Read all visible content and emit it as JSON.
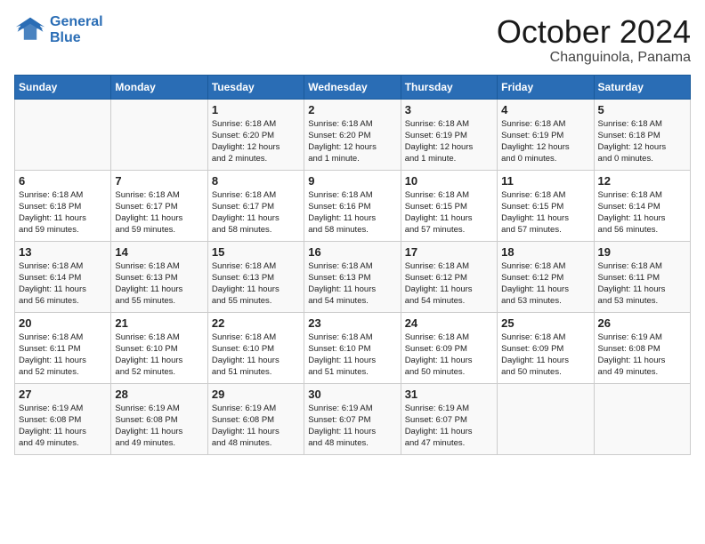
{
  "header": {
    "logo_line1": "General",
    "logo_line2": "Blue",
    "month": "October 2024",
    "location": "Changuinola, Panama"
  },
  "weekdays": [
    "Sunday",
    "Monday",
    "Tuesday",
    "Wednesday",
    "Thursday",
    "Friday",
    "Saturday"
  ],
  "weeks": [
    [
      {
        "day": "",
        "info": ""
      },
      {
        "day": "",
        "info": ""
      },
      {
        "day": "1",
        "info": "Sunrise: 6:18 AM\nSunset: 6:20 PM\nDaylight: 12 hours\nand 2 minutes."
      },
      {
        "day": "2",
        "info": "Sunrise: 6:18 AM\nSunset: 6:20 PM\nDaylight: 12 hours\nand 1 minute."
      },
      {
        "day": "3",
        "info": "Sunrise: 6:18 AM\nSunset: 6:19 PM\nDaylight: 12 hours\nand 1 minute."
      },
      {
        "day": "4",
        "info": "Sunrise: 6:18 AM\nSunset: 6:19 PM\nDaylight: 12 hours\nand 0 minutes."
      },
      {
        "day": "5",
        "info": "Sunrise: 6:18 AM\nSunset: 6:18 PM\nDaylight: 12 hours\nand 0 minutes."
      }
    ],
    [
      {
        "day": "6",
        "info": "Sunrise: 6:18 AM\nSunset: 6:18 PM\nDaylight: 11 hours\nand 59 minutes."
      },
      {
        "day": "7",
        "info": "Sunrise: 6:18 AM\nSunset: 6:17 PM\nDaylight: 11 hours\nand 59 minutes."
      },
      {
        "day": "8",
        "info": "Sunrise: 6:18 AM\nSunset: 6:17 PM\nDaylight: 11 hours\nand 58 minutes."
      },
      {
        "day": "9",
        "info": "Sunrise: 6:18 AM\nSunset: 6:16 PM\nDaylight: 11 hours\nand 58 minutes."
      },
      {
        "day": "10",
        "info": "Sunrise: 6:18 AM\nSunset: 6:15 PM\nDaylight: 11 hours\nand 57 minutes."
      },
      {
        "day": "11",
        "info": "Sunrise: 6:18 AM\nSunset: 6:15 PM\nDaylight: 11 hours\nand 57 minutes."
      },
      {
        "day": "12",
        "info": "Sunrise: 6:18 AM\nSunset: 6:14 PM\nDaylight: 11 hours\nand 56 minutes."
      }
    ],
    [
      {
        "day": "13",
        "info": "Sunrise: 6:18 AM\nSunset: 6:14 PM\nDaylight: 11 hours\nand 56 minutes."
      },
      {
        "day": "14",
        "info": "Sunrise: 6:18 AM\nSunset: 6:13 PM\nDaylight: 11 hours\nand 55 minutes."
      },
      {
        "day": "15",
        "info": "Sunrise: 6:18 AM\nSunset: 6:13 PM\nDaylight: 11 hours\nand 55 minutes."
      },
      {
        "day": "16",
        "info": "Sunrise: 6:18 AM\nSunset: 6:13 PM\nDaylight: 11 hours\nand 54 minutes."
      },
      {
        "day": "17",
        "info": "Sunrise: 6:18 AM\nSunset: 6:12 PM\nDaylight: 11 hours\nand 54 minutes."
      },
      {
        "day": "18",
        "info": "Sunrise: 6:18 AM\nSunset: 6:12 PM\nDaylight: 11 hours\nand 53 minutes."
      },
      {
        "day": "19",
        "info": "Sunrise: 6:18 AM\nSunset: 6:11 PM\nDaylight: 11 hours\nand 53 minutes."
      }
    ],
    [
      {
        "day": "20",
        "info": "Sunrise: 6:18 AM\nSunset: 6:11 PM\nDaylight: 11 hours\nand 52 minutes."
      },
      {
        "day": "21",
        "info": "Sunrise: 6:18 AM\nSunset: 6:10 PM\nDaylight: 11 hours\nand 52 minutes."
      },
      {
        "day": "22",
        "info": "Sunrise: 6:18 AM\nSunset: 6:10 PM\nDaylight: 11 hours\nand 51 minutes."
      },
      {
        "day": "23",
        "info": "Sunrise: 6:18 AM\nSunset: 6:10 PM\nDaylight: 11 hours\nand 51 minutes."
      },
      {
        "day": "24",
        "info": "Sunrise: 6:18 AM\nSunset: 6:09 PM\nDaylight: 11 hours\nand 50 minutes."
      },
      {
        "day": "25",
        "info": "Sunrise: 6:18 AM\nSunset: 6:09 PM\nDaylight: 11 hours\nand 50 minutes."
      },
      {
        "day": "26",
        "info": "Sunrise: 6:19 AM\nSunset: 6:08 PM\nDaylight: 11 hours\nand 49 minutes."
      }
    ],
    [
      {
        "day": "27",
        "info": "Sunrise: 6:19 AM\nSunset: 6:08 PM\nDaylight: 11 hours\nand 49 minutes."
      },
      {
        "day": "28",
        "info": "Sunrise: 6:19 AM\nSunset: 6:08 PM\nDaylight: 11 hours\nand 49 minutes."
      },
      {
        "day": "29",
        "info": "Sunrise: 6:19 AM\nSunset: 6:08 PM\nDaylight: 11 hours\nand 48 minutes."
      },
      {
        "day": "30",
        "info": "Sunrise: 6:19 AM\nSunset: 6:07 PM\nDaylight: 11 hours\nand 48 minutes."
      },
      {
        "day": "31",
        "info": "Sunrise: 6:19 AM\nSunset: 6:07 PM\nDaylight: 11 hours\nand 47 minutes."
      },
      {
        "day": "",
        "info": ""
      },
      {
        "day": "",
        "info": ""
      }
    ]
  ]
}
